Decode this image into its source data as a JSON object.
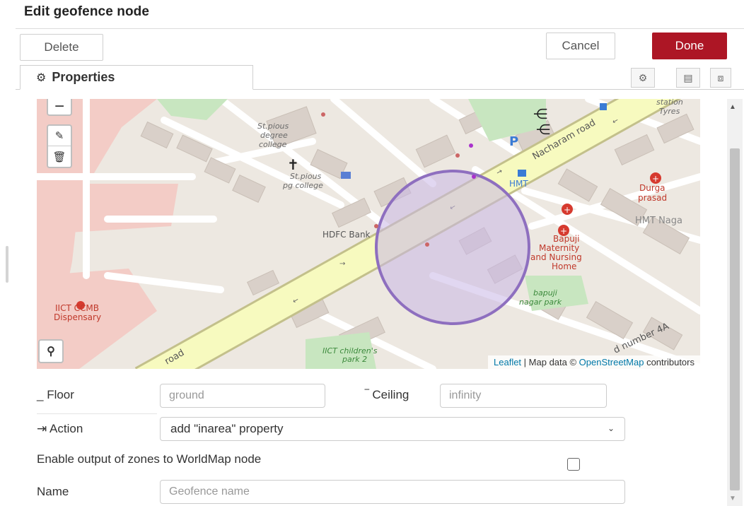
{
  "dialog": {
    "title": "Edit geofence node",
    "delete_label": "Delete",
    "cancel_label": "Cancel",
    "done_label": "Done",
    "tab_label": "Properties",
    "tab_icons": [
      "gear-icon",
      "description-icon",
      "appearance-icon"
    ]
  },
  "map": {
    "zoom_out_label": "−",
    "draw_icons": [
      "edit-icon",
      "trash-icon"
    ],
    "search_icon": "search-icon",
    "labels": {
      "st_pious_degree": [
        "St.pious",
        "degree",
        "college"
      ],
      "st_pious_pg": [
        "St.pious",
        "pg college"
      ],
      "nacharam_road": "Nacharam road",
      "hmt": "HMT",
      "hmt_naga": "HMT Naga",
      "durga": [
        "Durga",
        "prasad"
      ],
      "hdfc": "HDFC Bank",
      "bapuji_maternity": [
        "Bapuji",
        "Maternity",
        "and Nursing",
        "Home"
      ],
      "bapuji_park": [
        "bapuji",
        "nagar park"
      ],
      "iict_ccmb": [
        "IICT CCMB",
        "Dispensary"
      ],
      "iict_park": [
        "IICT children's",
        "park 2"
      ],
      "road_bottom": "road",
      "road_number": "d number 4A",
      "tyres": [
        "station",
        "Tyres"
      ]
    },
    "attribution": {
      "leaflet": "Leaflet",
      "sep": " | Map data © ",
      "osm": "OpenStreetMap",
      "suffix": " contributors"
    },
    "colors": {
      "road_main": "#f7fabf",
      "road_edge": "#c3c08b",
      "geofence_stroke": "#8e6fbf",
      "geofence_fill": "#c9b6e6",
      "building": "#d9d0c9",
      "military": "#f3ccc6",
      "park": "#c8e6c0"
    }
  },
  "form": {
    "floor_label": "Floor",
    "floor_placeholder": "ground",
    "ceiling_label": "Ceiling",
    "ceiling_placeholder": "infinity",
    "action_label": "Action",
    "action_value": "add \"inarea\" property",
    "worldmap_label": "Enable output of zones to WorldMap node",
    "worldmap_checked": false,
    "name_label": "Name",
    "name_placeholder": "Geofence name"
  }
}
